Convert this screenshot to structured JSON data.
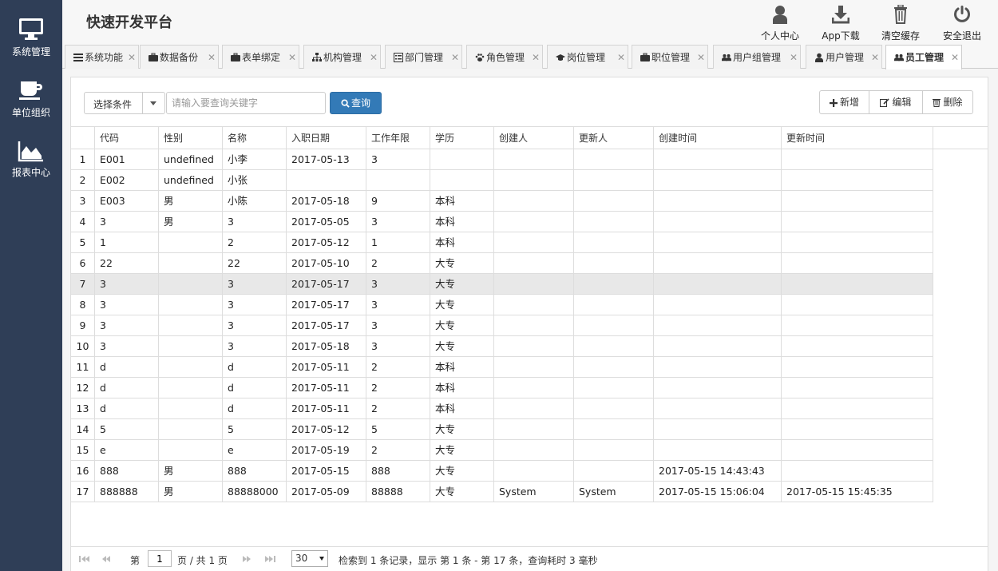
{
  "app": {
    "title": "快速开发平台"
  },
  "sidebar": {
    "items": [
      {
        "label": "系统管理",
        "icon": "monitor-icon"
      },
      {
        "label": "单位组织",
        "icon": "coffee-cup-icon"
      },
      {
        "label": "报表中心",
        "icon": "area-chart-icon"
      }
    ]
  },
  "header": {
    "buttons": [
      {
        "label": "个人中心",
        "icon": "user-icon"
      },
      {
        "label": "App下载",
        "icon": "download-icon"
      },
      {
        "label": "清空缓存",
        "icon": "trash-icon"
      },
      {
        "label": "安全退出",
        "icon": "power-icon"
      }
    ]
  },
  "tabs": [
    {
      "label": "系统功能",
      "icon": "list-icon"
    },
    {
      "label": "数据备份",
      "icon": "briefcase-icon"
    },
    {
      "label": "表单绑定",
      "icon": "briefcase-icon"
    },
    {
      "label": "机构管理",
      "icon": "sitemap-icon"
    },
    {
      "label": "部门管理",
      "icon": "list-alt-icon"
    },
    {
      "label": "角色管理",
      "icon": "paw-icon"
    },
    {
      "label": "岗位管理",
      "icon": "graduation-cap-icon"
    },
    {
      "label": "职位管理",
      "icon": "briefcase-icon"
    },
    {
      "label": "用户组管理",
      "icon": "users-icon"
    },
    {
      "label": "用户管理",
      "icon": "user-icon"
    },
    {
      "label": "员工管理",
      "icon": "users-icon",
      "active": true
    }
  ],
  "toolbar": {
    "select_label": "选择条件",
    "search_placeholder": "请输入要查询关键字",
    "query_label": "查询",
    "add_label": "新增",
    "edit_label": "编辑",
    "delete_label": "删除"
  },
  "grid": {
    "columns": [
      "代码",
      "性别",
      "名称",
      "入职日期",
      "工作年限",
      "学历",
      "创建人",
      "更新人",
      "创建时间",
      "更新时间"
    ],
    "rows": [
      {
        "n": "1",
        "c": [
          "E001",
          "undefined",
          "小李",
          "2017-05-13",
          "3",
          "",
          "",
          "",
          "",
          ""
        ]
      },
      {
        "n": "2",
        "c": [
          "E002",
          "undefined",
          "小张",
          "",
          "",
          "",
          "",
          "",
          "",
          ""
        ]
      },
      {
        "n": "3",
        "c": [
          "E003",
          "男",
          "小陈",
          "2017-05-18",
          "9",
          "本科",
          "",
          "",
          "",
          ""
        ]
      },
      {
        "n": "4",
        "c": [
          "3",
          "男",
          "3",
          "2017-05-05",
          "3",
          "本科",
          "",
          "",
          "",
          ""
        ]
      },
      {
        "n": "5",
        "c": [
          "1",
          "",
          "2",
          "2017-05-12",
          "1",
          "本科",
          "",
          "",
          "",
          ""
        ]
      },
      {
        "n": "6",
        "c": [
          "22",
          "",
          "22",
          "2017-05-10",
          "2",
          "大专",
          "",
          "",
          "",
          ""
        ]
      },
      {
        "n": "7",
        "c": [
          "3",
          "",
          "3",
          "2017-05-17",
          "3",
          "大专",
          "",
          "",
          "",
          ""
        ],
        "highlight": true
      },
      {
        "n": "8",
        "c": [
          "3",
          "",
          "3",
          "2017-05-17",
          "3",
          "大专",
          "",
          "",
          "",
          ""
        ]
      },
      {
        "n": "9",
        "c": [
          "3",
          "",
          "3",
          "2017-05-17",
          "3",
          "大专",
          "",
          "",
          "",
          ""
        ]
      },
      {
        "n": "10",
        "c": [
          "3",
          "",
          "3",
          "2017-05-18",
          "3",
          "大专",
          "",
          "",
          "",
          ""
        ]
      },
      {
        "n": "11",
        "c": [
          "d",
          "",
          "d",
          "2017-05-11",
          "2",
          "本科",
          "",
          "",
          "",
          ""
        ]
      },
      {
        "n": "12",
        "c": [
          "d",
          "",
          "d",
          "2017-05-11",
          "2",
          "本科",
          "",
          "",
          "",
          ""
        ]
      },
      {
        "n": "13",
        "c": [
          "d",
          "",
          "d",
          "2017-05-11",
          "2",
          "本科",
          "",
          "",
          "",
          ""
        ]
      },
      {
        "n": "14",
        "c": [
          "5",
          "",
          "5",
          "2017-05-12",
          "5",
          "大专",
          "",
          "",
          "",
          ""
        ]
      },
      {
        "n": "15",
        "c": [
          "e",
          "",
          "e",
          "2017-05-19",
          "2",
          "大专",
          "",
          "",
          "",
          ""
        ]
      },
      {
        "n": "16",
        "c": [
          "888",
          "男",
          "888",
          "2017-05-15",
          "888",
          "大专",
          "",
          "",
          "2017-05-15 14:43:43",
          ""
        ]
      },
      {
        "n": "17",
        "c": [
          "888888",
          "男",
          "88888000",
          "2017-05-09",
          "88888",
          "大专",
          "System",
          "System",
          "2017-05-15 15:06:04",
          "2017-05-15 15:45:35"
        ]
      }
    ]
  },
  "pager": {
    "page_prefix": "第",
    "page_value": "1",
    "page_suffix": "页 / 共 1 页",
    "page_size": "30",
    "info": "检索到 1 条记录，显示 第 1 条 - 第 17 条，查询耗时 3 毫秒"
  }
}
